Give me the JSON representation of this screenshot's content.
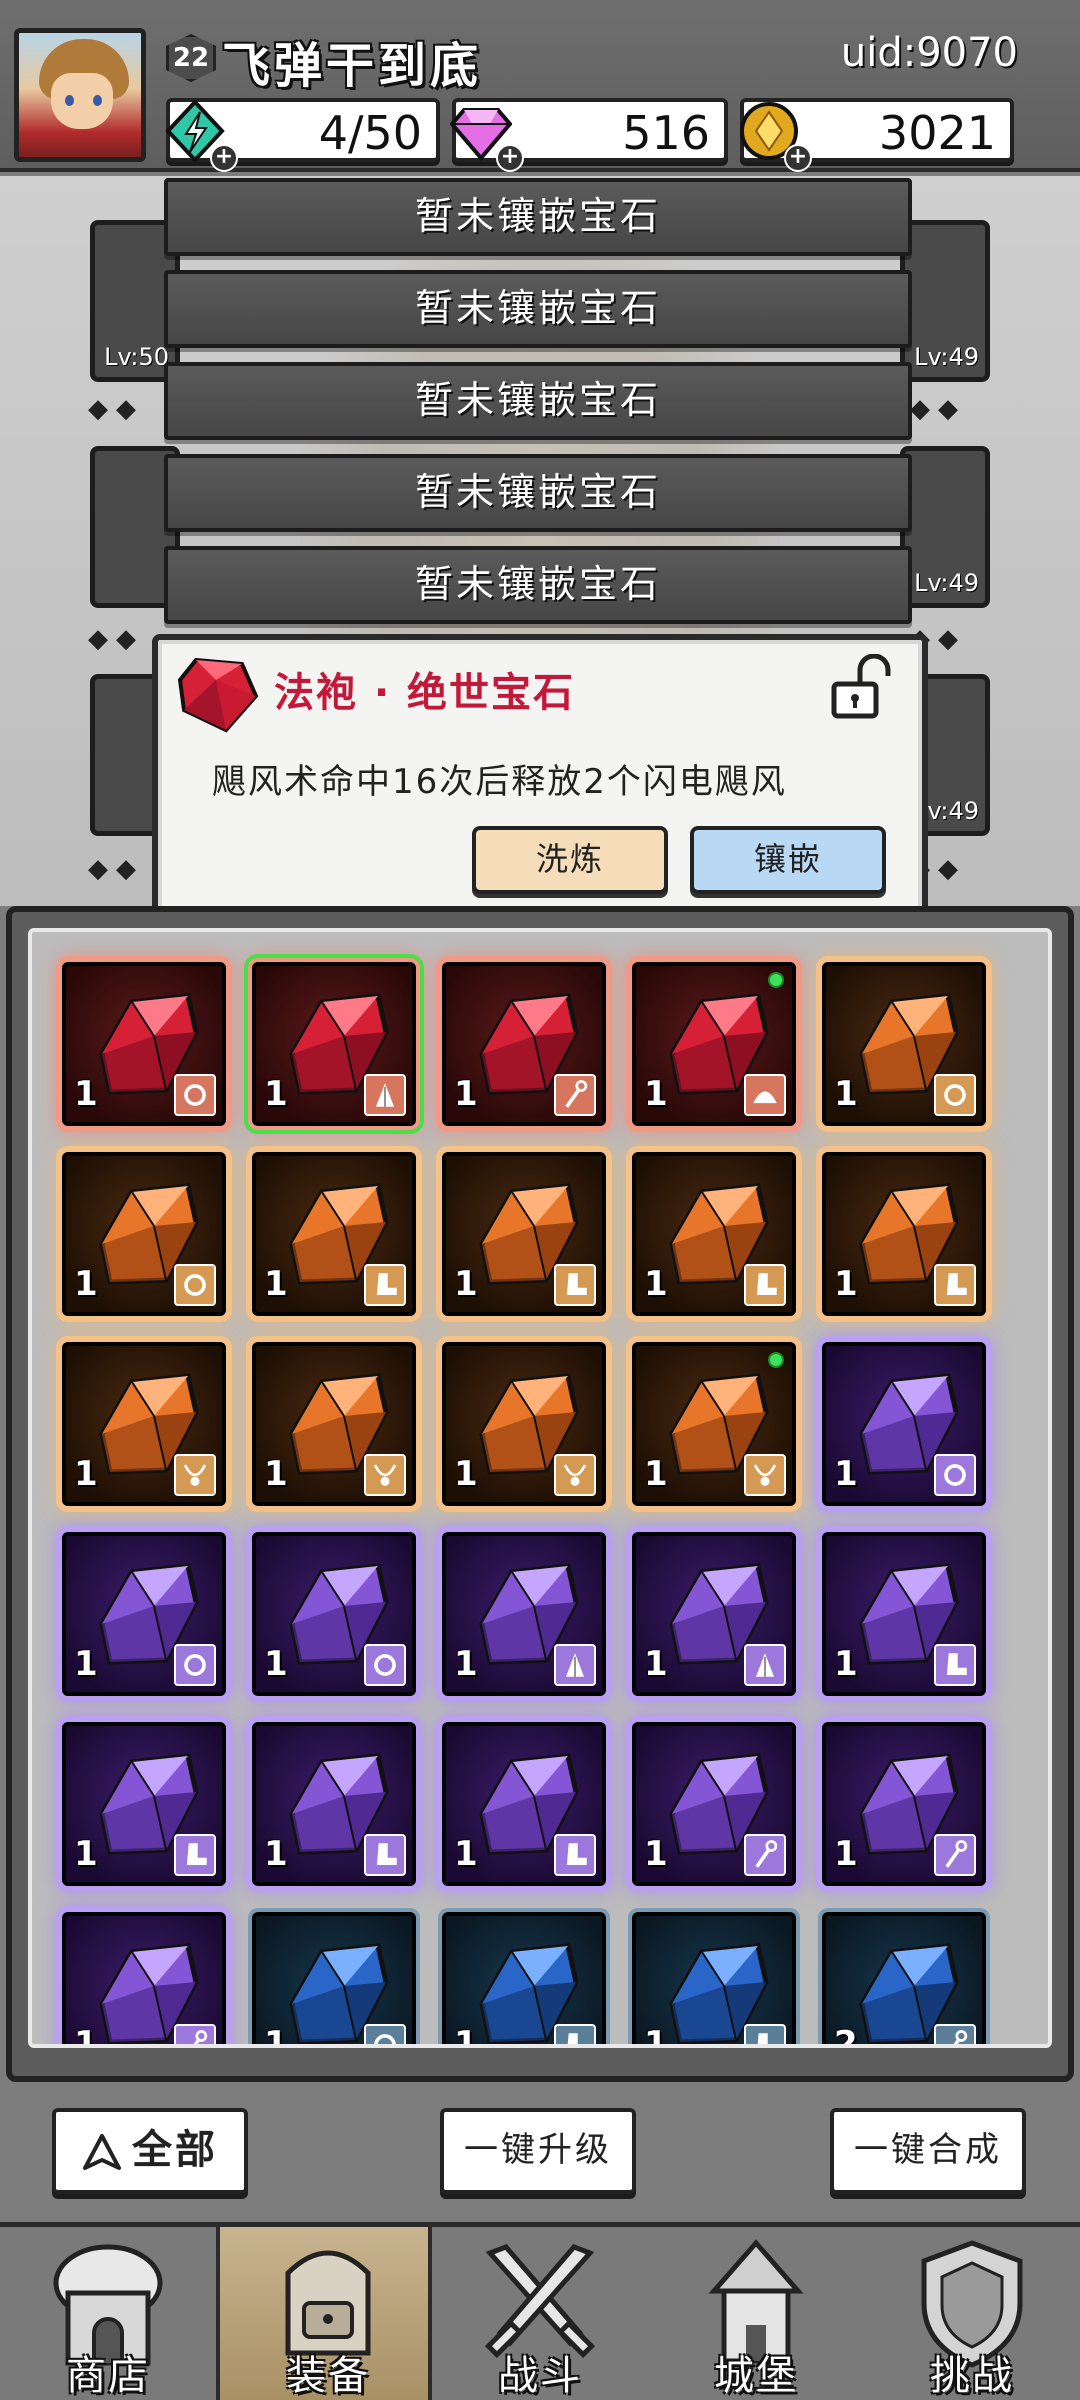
{
  "player": {
    "name": "飞弹干到底",
    "level": "22",
    "uid": "uid:9070"
  },
  "resources": {
    "energy": "4/50",
    "diamonds": "516",
    "gold": "3021"
  },
  "equipment": {
    "right_levels": [
      "Lv:49",
      "Lv:49",
      "Lv:49"
    ],
    "left_levels": [
      "Lv:50"
    ]
  },
  "gem_slots": [
    "暂未镶嵌宝石",
    "暂未镶嵌宝石",
    "暂未镶嵌宝石",
    "暂未镶嵌宝石",
    "暂未镶嵌宝石"
  ],
  "tooltip": {
    "title": "法袍 · 绝世宝石",
    "description": "飓风术命中16次后释放2个闪电飓风",
    "refine_label": "洗炼",
    "inlay_label": "镶嵌"
  },
  "gems": [
    {
      "color": "red",
      "count": "1",
      "slot": "ring"
    },
    {
      "color": "red",
      "count": "1",
      "slot": "robe",
      "selected": true
    },
    {
      "color": "red",
      "count": "1",
      "slot": "wand"
    },
    {
      "color": "red",
      "count": "1",
      "slot": "hat",
      "new": true
    },
    {
      "color": "orange",
      "count": "1",
      "slot": "ring"
    },
    {
      "color": "orange",
      "count": "1",
      "slot": "ring"
    },
    {
      "color": "orange",
      "count": "1",
      "slot": "boot"
    },
    {
      "color": "orange",
      "count": "1",
      "slot": "boot"
    },
    {
      "color": "orange",
      "count": "1",
      "slot": "boot"
    },
    {
      "color": "orange",
      "count": "1",
      "slot": "boot"
    },
    {
      "color": "orange",
      "count": "1",
      "slot": "necklace"
    },
    {
      "color": "orange",
      "count": "1",
      "slot": "necklace"
    },
    {
      "color": "orange",
      "count": "1",
      "slot": "necklace"
    },
    {
      "color": "orange",
      "count": "1",
      "slot": "necklace",
      "new": true
    },
    {
      "color": "purple",
      "count": "1",
      "slot": "ring"
    },
    {
      "color": "purple",
      "count": "1",
      "slot": "ring"
    },
    {
      "color": "purple",
      "count": "1",
      "slot": "ring"
    },
    {
      "color": "purple",
      "count": "1",
      "slot": "robe"
    },
    {
      "color": "purple",
      "count": "1",
      "slot": "robe"
    },
    {
      "color": "purple",
      "count": "1",
      "slot": "boot"
    },
    {
      "color": "purple",
      "count": "1",
      "slot": "boot"
    },
    {
      "color": "purple",
      "count": "1",
      "slot": "boot"
    },
    {
      "color": "purple",
      "count": "1",
      "slot": "boot"
    },
    {
      "color": "purple",
      "count": "1",
      "slot": "wand"
    },
    {
      "color": "purple",
      "count": "1",
      "slot": "wand"
    },
    {
      "color": "purple",
      "count": "1",
      "slot": "wand"
    },
    {
      "color": "blue",
      "count": "1",
      "slot": "ring"
    },
    {
      "color": "blue",
      "count": "1",
      "slot": "boot"
    },
    {
      "color": "blue",
      "count": "1",
      "slot": "boot"
    },
    {
      "color": "blue",
      "count": "2",
      "slot": "wand"
    }
  ],
  "actions": {
    "all": "全部",
    "upgrade": "一键升级",
    "merge": "一键合成"
  },
  "nav": [
    {
      "label": "商店",
      "icon": "shop-icon"
    },
    {
      "label": "装备",
      "icon": "backpack-icon",
      "active": true
    },
    {
      "label": "战斗",
      "icon": "crossed-swords-icon"
    },
    {
      "label": "城堡",
      "icon": "castle-icon"
    },
    {
      "label": "挑战",
      "icon": "shield-icon"
    }
  ],
  "colors": {
    "red": "#e8344a",
    "orange": "#f08a3a",
    "purple": "#9a6ae6",
    "blue": "#3a7ad8",
    "title_red": "#c4183a"
  }
}
